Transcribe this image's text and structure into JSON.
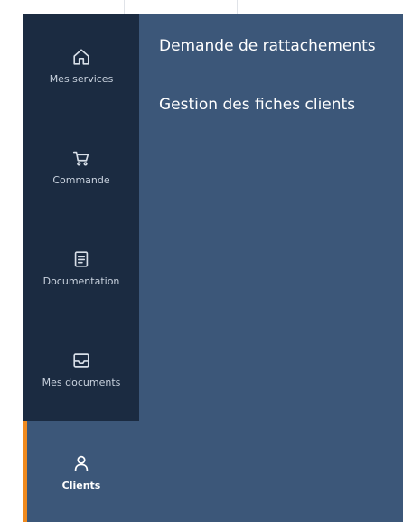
{
  "sidebar": {
    "items": [
      {
        "label": "Mes services",
        "icon": "home-icon",
        "active": false
      },
      {
        "label": "Commande",
        "icon": "cart-icon",
        "active": false
      },
      {
        "label": "Documentation",
        "icon": "document-icon",
        "active": false
      },
      {
        "label": "Mes documents",
        "icon": "inbox-icon",
        "active": false
      },
      {
        "label": "Clients",
        "icon": "user-icon",
        "active": true
      }
    ]
  },
  "submenu": {
    "items": [
      {
        "label": "Demande de rattachements"
      },
      {
        "label": "Gestion des fiches clients"
      }
    ]
  },
  "colors": {
    "sidebar_bg": "#1b2b41",
    "panel_bg": "#3c5779",
    "accent": "#f08a1e",
    "text": "#ffffff"
  }
}
